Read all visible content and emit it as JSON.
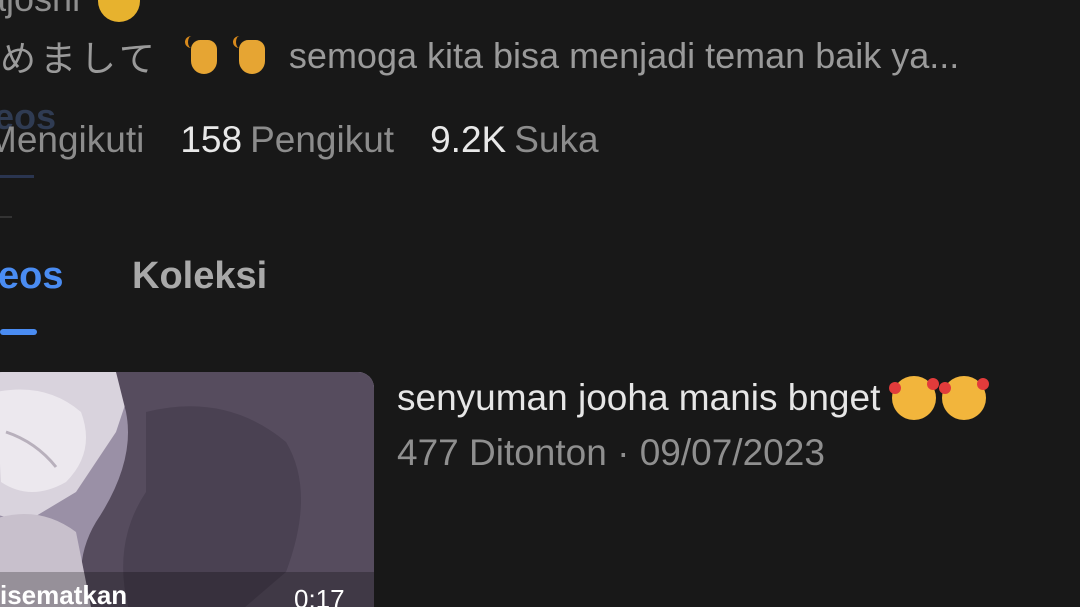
{
  "profile": {
    "username_partial": "ajoshi",
    "username_emoji_icon": "grinning-face-icon",
    "bio_japanese": "はじめまして",
    "bio_visible_japanese": "めまして",
    "bio_icons": [
      "waving-hand-icon",
      "waving-hand-icon"
    ],
    "bio_text": "semoga kita bisa menjadi teman baik ya..."
  },
  "stats": {
    "following_label": "Mengikuti",
    "followers_count": "158",
    "followers_label": "Pengikut",
    "likes_count": "9.2K",
    "likes_label": "Suka"
  },
  "ghost_tab_label": "eos",
  "tabs": [
    {
      "label": "eos",
      "active": true
    },
    {
      "label": "Koleksi",
      "active": false
    }
  ],
  "video": {
    "title": "senyuman jooha manis bnget",
    "title_icons": [
      "smiling-face-with-hearts-icon",
      "smiling-face-with-hearts-icon"
    ],
    "views": "477 Ditonton",
    "separator": "·",
    "date": "09/07/2023",
    "pinned_label": "isematkan",
    "duration": "0:17"
  },
  "colors": {
    "background": "#181818",
    "accent": "#4a8cf2",
    "primary_text": "#e8e8e8",
    "secondary_text": "#8f8f8f"
  }
}
